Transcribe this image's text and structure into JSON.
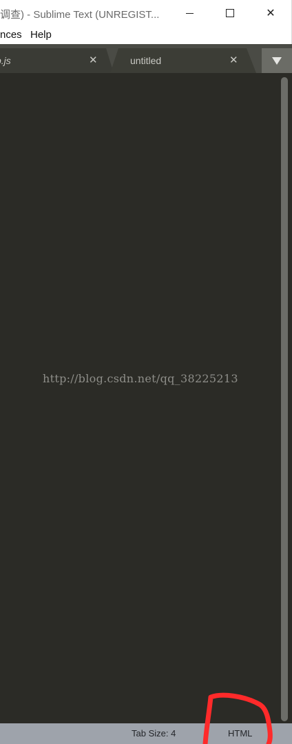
{
  "window": {
    "title": "调查) - Sublime Text (UNREGIST...",
    "min_icon": "minimize-icon",
    "max_icon": "maximize-icon",
    "close_icon": "close-icon",
    "close_glyph": "✕"
  },
  "menu": {
    "items": [
      {
        "label": "nces"
      },
      {
        "label": "Help"
      }
    ]
  },
  "tabs": [
    {
      "label": "p.js",
      "close": "✕",
      "italic": true
    },
    {
      "label": "untitled",
      "close": "✕",
      "italic": false
    }
  ],
  "tab_overflow_icon": "triangle-down-icon",
  "editor": {
    "watermark": "http://blog.csdn.net/qq_38225213"
  },
  "status": {
    "tab_size": "Tab Size: 4",
    "syntax": "HTML"
  },
  "colors": {
    "editor_bg": "#2b2b26",
    "tab_strip_bg": "#4a4b45",
    "status_bg": "#9ea3ab",
    "annotation": "#ff2a2a"
  }
}
